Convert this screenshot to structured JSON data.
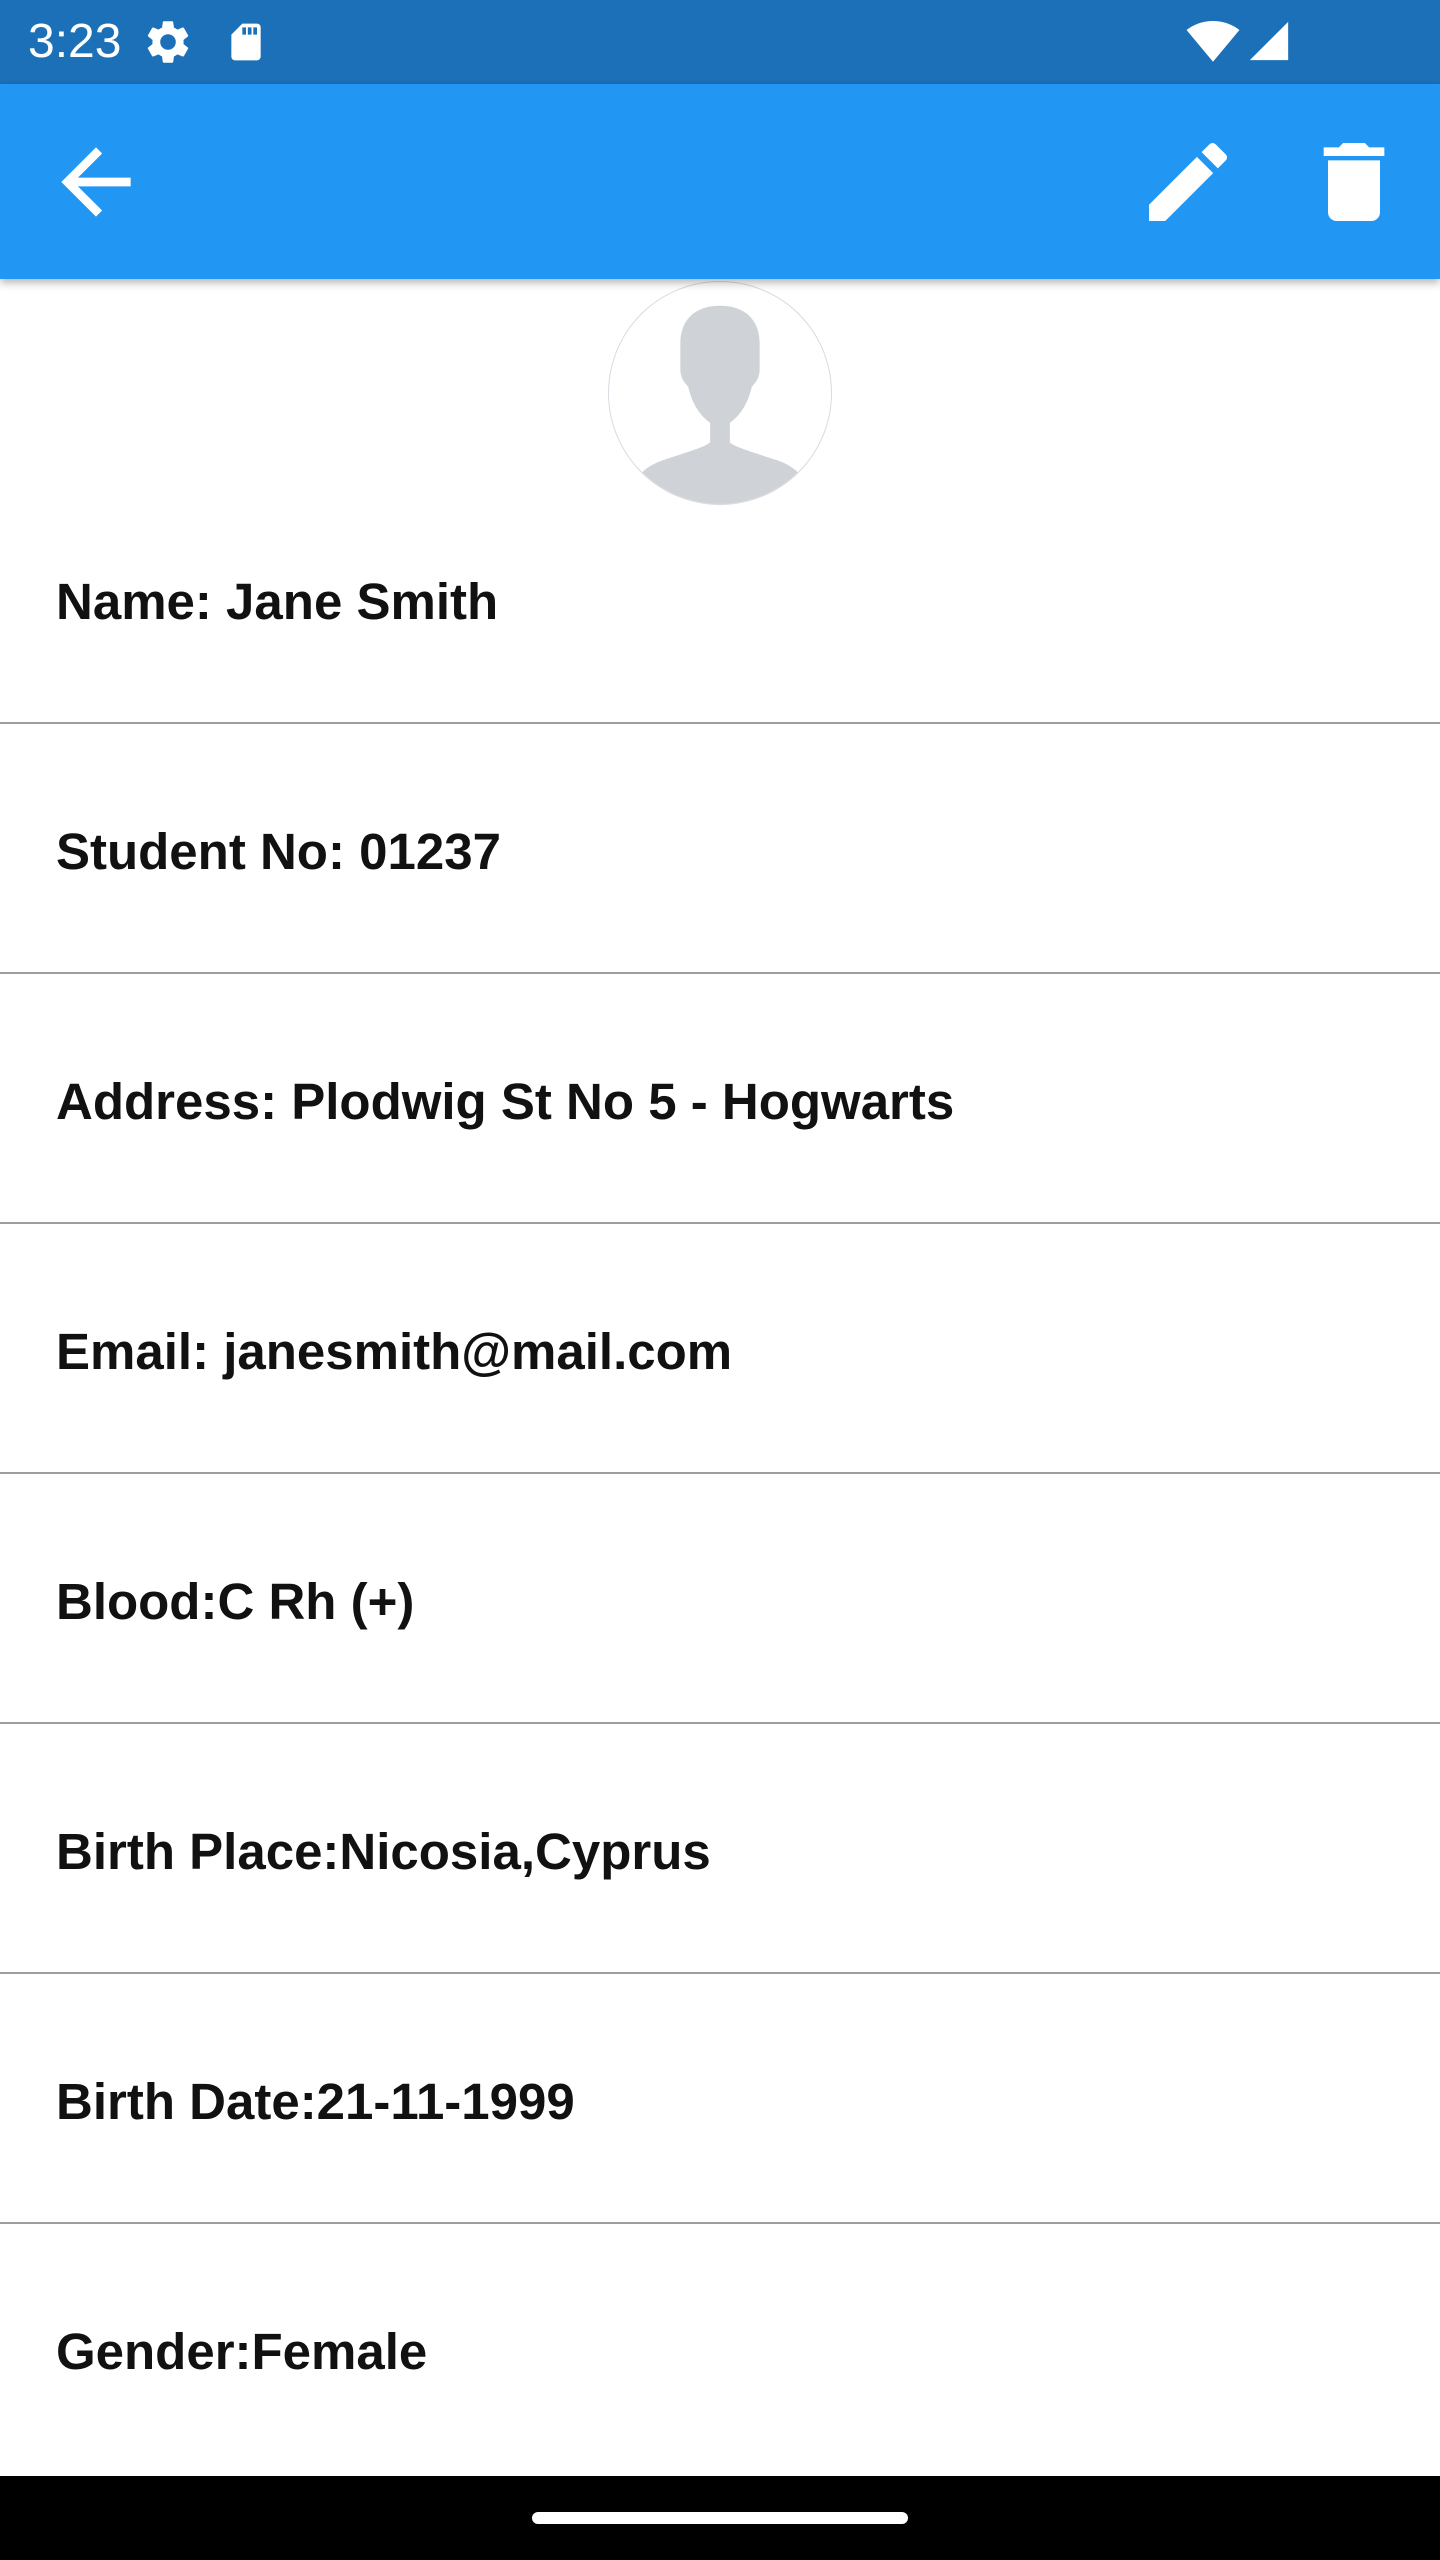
{
  "status_bar": {
    "time": "3:23",
    "background_color": "#1b70b7",
    "icons": [
      "settings-gear-icon",
      "sd-card-icon",
      "wifi-icon",
      "cell-signal-icon"
    ]
  },
  "app_bar": {
    "background_color": "#2196f3",
    "back_icon": "arrow-back-icon",
    "edit_icon": "edit-pencil-icon",
    "delete_icon": "delete-trash-icon"
  },
  "profile": {
    "avatar_icon": "person-placeholder-icon",
    "fields": [
      {
        "label": "Name: Jane Smith"
      },
      {
        "label": "Student No: 01237"
      },
      {
        "label": "Address: Plodwig St No 5 - Hogwarts"
      },
      {
        "label": "Email: janesmith@mail.com"
      },
      {
        "label": "Blood:C Rh (+)"
      },
      {
        "label": "Birth Place:Nicosia,Cyprus"
      },
      {
        "label": "Birth Date:21-11-1999"
      },
      {
        "label": "Gender:Female"
      }
    ]
  }
}
